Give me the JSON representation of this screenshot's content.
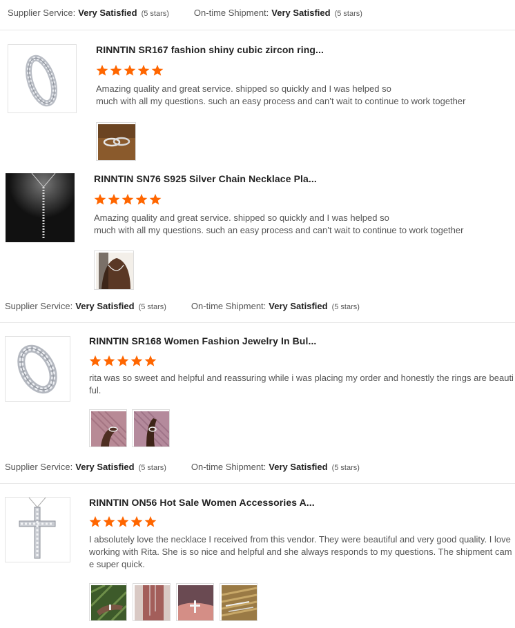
{
  "labels": {
    "supplier_service": "Supplier Service:",
    "ontime_shipment": "On-time Shipment:"
  },
  "top_rating": {
    "supplier_value": "Very Satisfied",
    "supplier_stars": "(5 stars)",
    "shipment_value": "Very Satisfied",
    "shipment_stars": "(5 stars)"
  },
  "reviews": [
    {
      "title": "RINNTIN SR167 fashion shiny cubic zircon ring...",
      "rating": 5,
      "text_lines": [
        "Amazing quality and great service. shipped so quickly and I was helped so",
        "much with all my questions. such an easy process and can’t wait to continue to work together"
      ],
      "photo_count": 1
    },
    {
      "title": "RINNTIN SN76 S925 Silver Chain Necklace Pla...",
      "rating": 5,
      "text_lines": [
        "Amazing quality and great service. shipped so quickly and I was helped so",
        "much with all my questions. such an easy process and can’t wait to continue to work together"
      ],
      "photo_count": 1,
      "supplier_value": "Very Satisfied",
      "supplier_stars": "(5 stars)",
      "shipment_value": "Very Satisfied",
      "shipment_stars": "(5 stars)"
    },
    {
      "title": "RINNTIN SR168 Women Fashion Jewelry In Bul...",
      "rating": 5,
      "text_lines": [
        "rita was so sweet and helpful and reassuring while i was placing my order and honestly the rings are beauti",
        "ful."
      ],
      "photo_count": 2,
      "supplier_value": "Very Satisfied",
      "supplier_stars": "(5 stars)",
      "shipment_value": "Very Satisfied",
      "shipment_stars": "(5 stars)"
    },
    {
      "title": "RINNTIN ON56 Hot Sale Women Accessories A...",
      "rating": 5,
      "text_lines": [
        "I absolutely love the necklace I received from this vendor. They were beautiful and very good quality.  I love",
        "working with Rita. She is so nice and helpful and she always responds to my questions. The shipment cam",
        "e super quick."
      ],
      "photo_count": 4
    }
  ],
  "colors": {
    "star": "#ff6600",
    "divider": "#e6e6e6"
  },
  "icons": {
    "star": "star-icon"
  }
}
